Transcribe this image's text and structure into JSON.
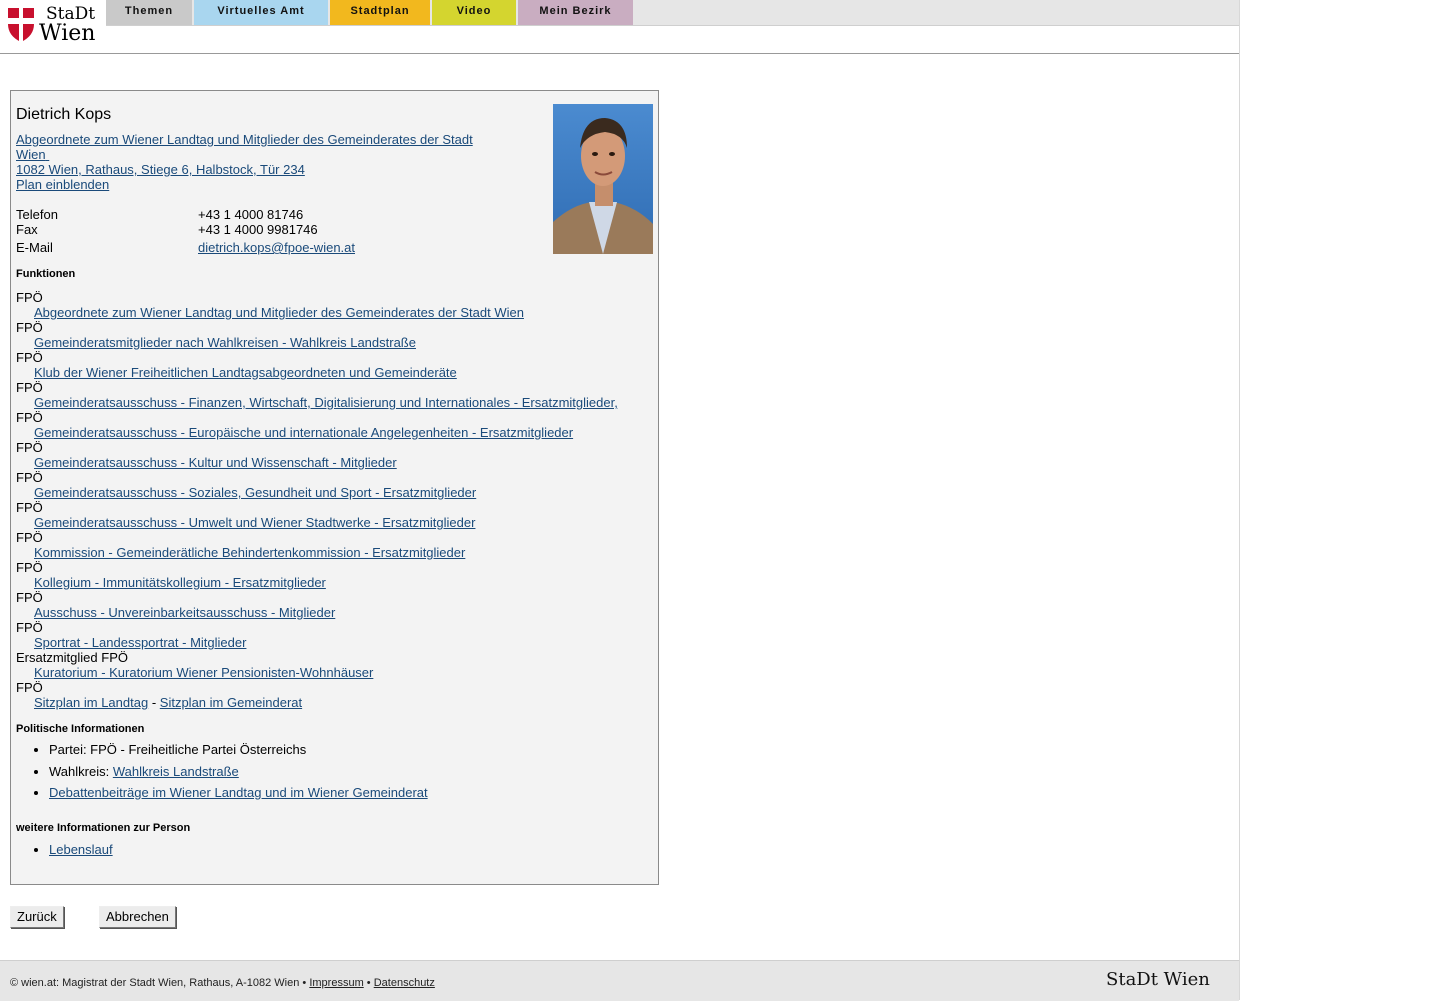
{
  "header": {
    "logo_text_top": "StaDt",
    "logo_text_bottom": "Wien",
    "nav": [
      {
        "label": "Themen",
        "color": "#c9c9c9"
      },
      {
        "label": "Virtuelles Amt",
        "color": "#a9d6ef"
      },
      {
        "label": "Stadtplan",
        "color": "#f2b81e"
      },
      {
        "label": "Video",
        "color": "#d4d52f"
      },
      {
        "label": "Mein Bezirk",
        "color": "#c9adc1"
      }
    ]
  },
  "person": {
    "name": "Dietrich Kops",
    "role_link_line1": "Abgeordnete zum Wiener Landtag und Mitglieder des Gemeinderates der Stadt",
    "role_link_line2": "Wien",
    "address_link": "1082 Wien, Rathaus, Stiege 6, Halbstock, Tür 234",
    "plan_link": "Plan einblenden",
    "phone_label": "Telefon",
    "phone": "+43 1 4000 81746",
    "fax_label": "Fax",
    "fax": "+43 1 4000 9981746",
    "email_label": "E-Mail",
    "email": "dietrich.kops@fpoe-wien.at"
  },
  "functions": {
    "title": "Funktionen",
    "items": [
      {
        "party": "FPÖ",
        "link": "Abgeordnete zum Wiener Landtag und Mitglieder des Gemeinderates der Stadt Wien"
      },
      {
        "party": "FPÖ",
        "link": "Gemeinderatsmitglieder nach Wahlkreisen - Wahlkreis Landstraße"
      },
      {
        "party": "FPÖ",
        "link": "Klub der Wiener Freiheitlichen Landtagsabgeordneten und Gemeinderäte"
      },
      {
        "party": "FPÖ",
        "link": "Gemeinderatsausschuss - Finanzen, Wirtschaft, Digitalisierung und Internationales - Ersatzmitglieder,"
      },
      {
        "party": "FPÖ",
        "link": "Gemeinderatsausschuss - Europäische und internationale Angelegenheiten - Ersatzmitglieder"
      },
      {
        "party": "FPÖ",
        "link": "Gemeinderatsausschuss - Kultur und Wissenschaft - Mitglieder"
      },
      {
        "party": "FPÖ",
        "link": "Gemeinderatsausschuss - Soziales, Gesundheit und Sport - Ersatzmitglieder"
      },
      {
        "party": "FPÖ",
        "link": "Gemeinderatsausschuss - Umwelt und Wiener Stadtwerke - Ersatzmitglieder"
      },
      {
        "party": "FPÖ",
        "link": "Kommission - Gemeinderätliche Behindertenkommission - Ersatzmitglieder"
      },
      {
        "party": "FPÖ",
        "link": "Kollegium - Immunitätskollegium - Ersatzmitglieder"
      },
      {
        "party": "FPÖ",
        "link": "Ausschuss - Unvereinbarkeitsausschuss - Mitglieder"
      },
      {
        "party": "FPÖ",
        "link": "Sportrat - Landessportrat - Mitglieder"
      },
      {
        "party": "Ersatzmitglied FPÖ",
        "link": "Kuratorium - Kuratorium Wiener Pensionisten-Wohnhäuser"
      }
    ],
    "last_party": "FPÖ",
    "sitzplan_landtag": "Sitzplan im Landtag",
    "sitzplan_separator": "-",
    "sitzplan_gemeinderat": "Sitzplan im Gemeinderat"
  },
  "political": {
    "title": "Politische Informationen",
    "partei_label": "Partei: FPÖ - Freiheitliche Partei Österreichs",
    "wahlkreis_label": "Wahlkreis:",
    "wahlkreis_link": "Wahlkreis Landstraße",
    "debatten_link": "Debattenbeiträge im Wiener Landtag und im Wiener Gemeinderat"
  },
  "more_info": {
    "title": "weitere Informationen zur Person",
    "lebenslauf": "Lebenslauf"
  },
  "buttons": {
    "back": "Zurück",
    "cancel": "Abbrechen"
  },
  "footer": {
    "copyright": "© wien.at: Magistrat der Stadt Wien, Rathaus, A-1082 Wien •",
    "impressum": "Impressum",
    "bullet": "•",
    "datenschutz": "Datenschutz",
    "logo_text": "StaDt Wien"
  }
}
